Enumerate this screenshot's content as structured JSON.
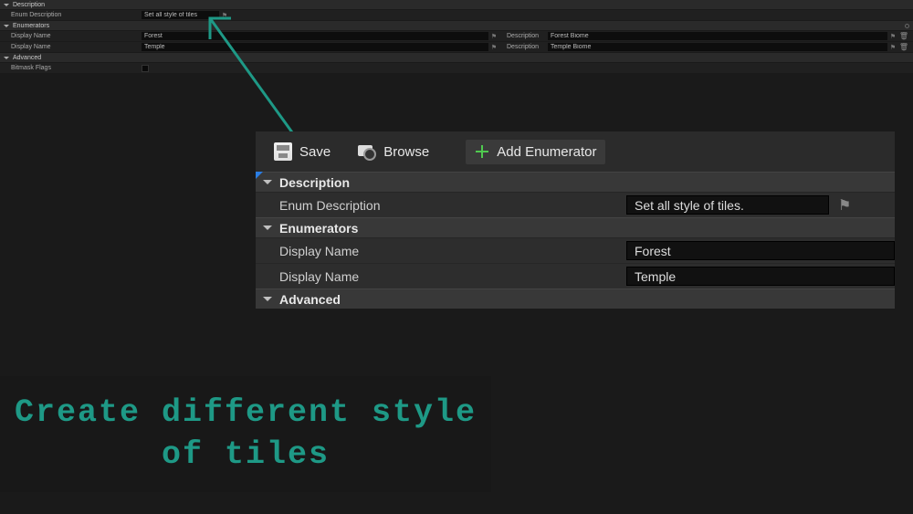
{
  "small_panel": {
    "sections": {
      "description": {
        "label": "Description"
      },
      "enumerators": {
        "label": "Enumerators"
      },
      "advanced": {
        "label": "Advanced"
      }
    },
    "enum_description": {
      "label": "Enum Description",
      "value": "Set all style of tiles"
    },
    "rows": [
      {
        "display_name_label": "Display Name",
        "display_name": "Forest",
        "description_label": "Description",
        "description": "Forest Biome"
      },
      {
        "display_name_label": "Display Name",
        "display_name": "Temple",
        "description_label": "Description",
        "description": "Temple Biome"
      }
    ],
    "bitmask": {
      "label": "Bitmask Flags"
    }
  },
  "toolbar": {
    "save_label": "Save",
    "browse_label": "Browse",
    "add_enum_label": "Add Enumerator"
  },
  "large_panel": {
    "sections": {
      "description": {
        "label": "Description"
      },
      "enumerators": {
        "label": "Enumerators"
      },
      "advanced": {
        "label": "Advanced"
      }
    },
    "enum_description": {
      "label": "Enum Description",
      "value": "Set all style of tiles."
    },
    "rows": [
      {
        "label": "Display Name",
        "value": "Forest"
      },
      {
        "label": "Display Name",
        "value": "Temple"
      }
    ]
  },
  "caption": {
    "line1": "Create different style",
    "line2": "of tiles"
  }
}
